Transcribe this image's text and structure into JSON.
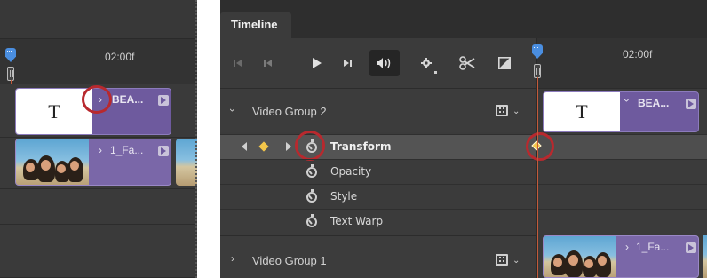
{
  "left_panel": {
    "time_label": "02:00f",
    "clips": [
      {
        "name": "BEA...",
        "thumb_letter": "T"
      },
      {
        "name": "1_Fa..."
      }
    ]
  },
  "right_panel": {
    "tab": "Timeline",
    "time_label": "02:00f",
    "toolbar": {
      "buttons": [
        {
          "icon": "go-to-first-frame-icon"
        },
        {
          "icon": "previous-frame-icon"
        },
        {
          "icon": "play-icon"
        },
        {
          "icon": "next-frame-icon"
        },
        {
          "icon": "audio-icon"
        },
        {
          "icon": "settings-gear-icon"
        },
        {
          "icon": "split-scissors-icon"
        },
        {
          "icon": "transition-icon"
        }
      ]
    },
    "groups": [
      {
        "label": "Video Group 2"
      },
      {
        "label": "Video Group 1"
      }
    ],
    "properties": [
      {
        "label": "Transform"
      },
      {
        "label": "Opacity"
      },
      {
        "label": "Style"
      },
      {
        "label": "Text Warp"
      }
    ],
    "clips": [
      {
        "name": "BEA...",
        "thumb_letter": "T"
      },
      {
        "name": "1_Fa..."
      }
    ]
  },
  "colors": {
    "panel_bg": "#3b3b3b",
    "clip_purple": "#7a67a8",
    "playhead": "#4a8ee0",
    "keyframe": "#f3c64a",
    "callout": "#b8292e"
  }
}
